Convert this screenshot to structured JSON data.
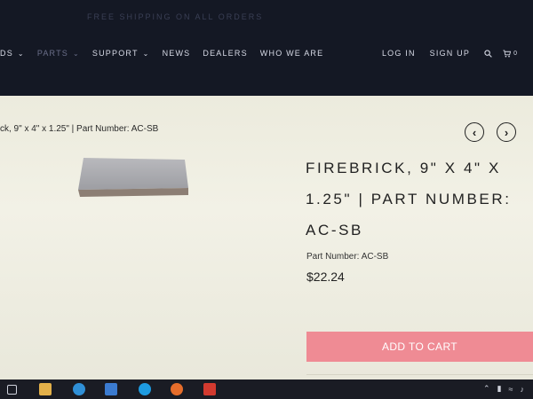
{
  "header": {
    "promo": "FREE SHIPPING ON ALL ORDERS",
    "nav_items": [
      {
        "label": "DS",
        "active": false
      },
      {
        "label": "PARTS",
        "active": true
      },
      {
        "label": "SUPPORT",
        "active": false
      },
      {
        "label": "NEWS",
        "active": false
      },
      {
        "label": "DEALERS",
        "active": false
      },
      {
        "label": "WHO WE ARE",
        "active": false
      }
    ],
    "login": "LOG IN",
    "signup": "SIGN UP",
    "cart_count": "0"
  },
  "breadcrumb": "ck, 9\" x 4\" x 1.25\" | Part Number: AC-SB",
  "product": {
    "title": "FIREBRICK, 9\" X 4\" X 1.25\" | PART NUMBER: AC-SB",
    "part_number": "Part Number: AC-SB",
    "price": "$22.24",
    "add_to_cart": "ADD TO CART"
  },
  "colors": {
    "header_bg": "#141824",
    "content_bg": "#ecebdd",
    "accent_button": "#ef8b94",
    "nav_active": "#6b6f8a"
  },
  "icons": {
    "prev": "chevron-left-icon",
    "next": "chevron-right-icon",
    "search": "search-icon",
    "cart": "cart-icon"
  }
}
